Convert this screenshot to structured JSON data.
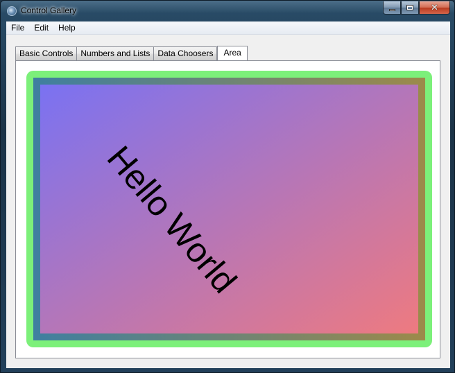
{
  "window": {
    "title": "Control Gallery"
  },
  "menu": {
    "items": [
      "File",
      "Edit",
      "Help"
    ]
  },
  "tabs": [
    {
      "label": "Basic Controls"
    },
    {
      "label": "Numbers and Lists"
    },
    {
      "label": "Data Choosers"
    },
    {
      "label": "Area"
    }
  ],
  "active_tab": "Area",
  "area": {
    "text": "Hello World",
    "colors": {
      "outer_border": "#7cf07a",
      "gradient_start": "#7a72f2",
      "gradient_end": "#ee7a80",
      "text": "#000000"
    }
  }
}
